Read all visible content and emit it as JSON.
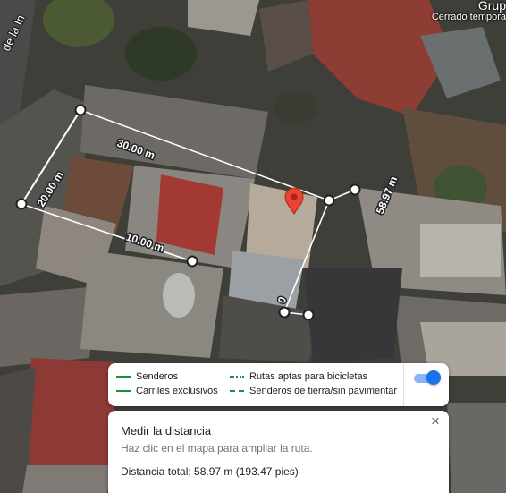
{
  "poi": {
    "name": "Grup",
    "status": "Cerrado tempora"
  },
  "street_label": "de la In",
  "measurement": {
    "segments": [
      "30.00 m",
      "20.00 m",
      "10.00 m",
      "58.97 m",
      "0"
    ]
  },
  "legend": {
    "items": [
      {
        "label": "Senderos",
        "style": "solid"
      },
      {
        "label": "Carriles exclusivos",
        "style": "solid"
      },
      {
        "label": "Rutas aptas para bicicletas",
        "style": "dotted"
      },
      {
        "label": "Senderos de tierra/sin pavimentar",
        "style": "dashed"
      }
    ],
    "toggle_on": true
  },
  "measure_panel": {
    "title": "Medir la distancia",
    "hint": "Haz clic en el mapa para ampliar la ruta.",
    "total": "Distancia total: 58.97 m (193.47 pies)",
    "close_icon": "×"
  },
  "colors": {
    "path_line": "#ffffff",
    "pin": "#ea4335",
    "legend_green": "#1e8e3e",
    "toggle_accent": "#1a73e8"
  }
}
